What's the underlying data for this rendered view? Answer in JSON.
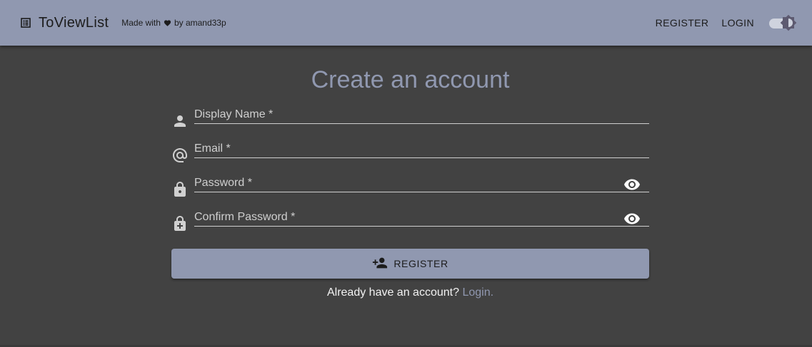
{
  "header": {
    "brand_icon": "list-icon",
    "title": "ToViewList",
    "made_with_prefix": "Made with",
    "heart_icon": "heart-icon",
    "made_with_suffix": "by amand33p",
    "nav": {
      "register_label": "REGISTER",
      "login_label": "LOGIN"
    },
    "theme_toggle_icon": "brightness-icon"
  },
  "form": {
    "title": "Create an account",
    "fields": [
      {
        "icon": "person-icon",
        "placeholder": "Display Name *",
        "value": ""
      },
      {
        "icon": "at-sign-icon",
        "placeholder": "Email *",
        "value": ""
      },
      {
        "icon": "lock-icon",
        "placeholder": "Password *",
        "value": "",
        "toggle_icon": "eye-icon"
      },
      {
        "icon": "lock-plus-icon",
        "placeholder": "Confirm Password *",
        "value": "",
        "toggle_icon": "eye-icon"
      }
    ],
    "submit_label": "REGISTER",
    "submit_icon": "person-add-icon",
    "login_prompt": "Already have an account?",
    "login_link": "Login."
  },
  "colors": {
    "primary": "#9098b0",
    "background": "#424242",
    "text": "#e0e0e0"
  }
}
